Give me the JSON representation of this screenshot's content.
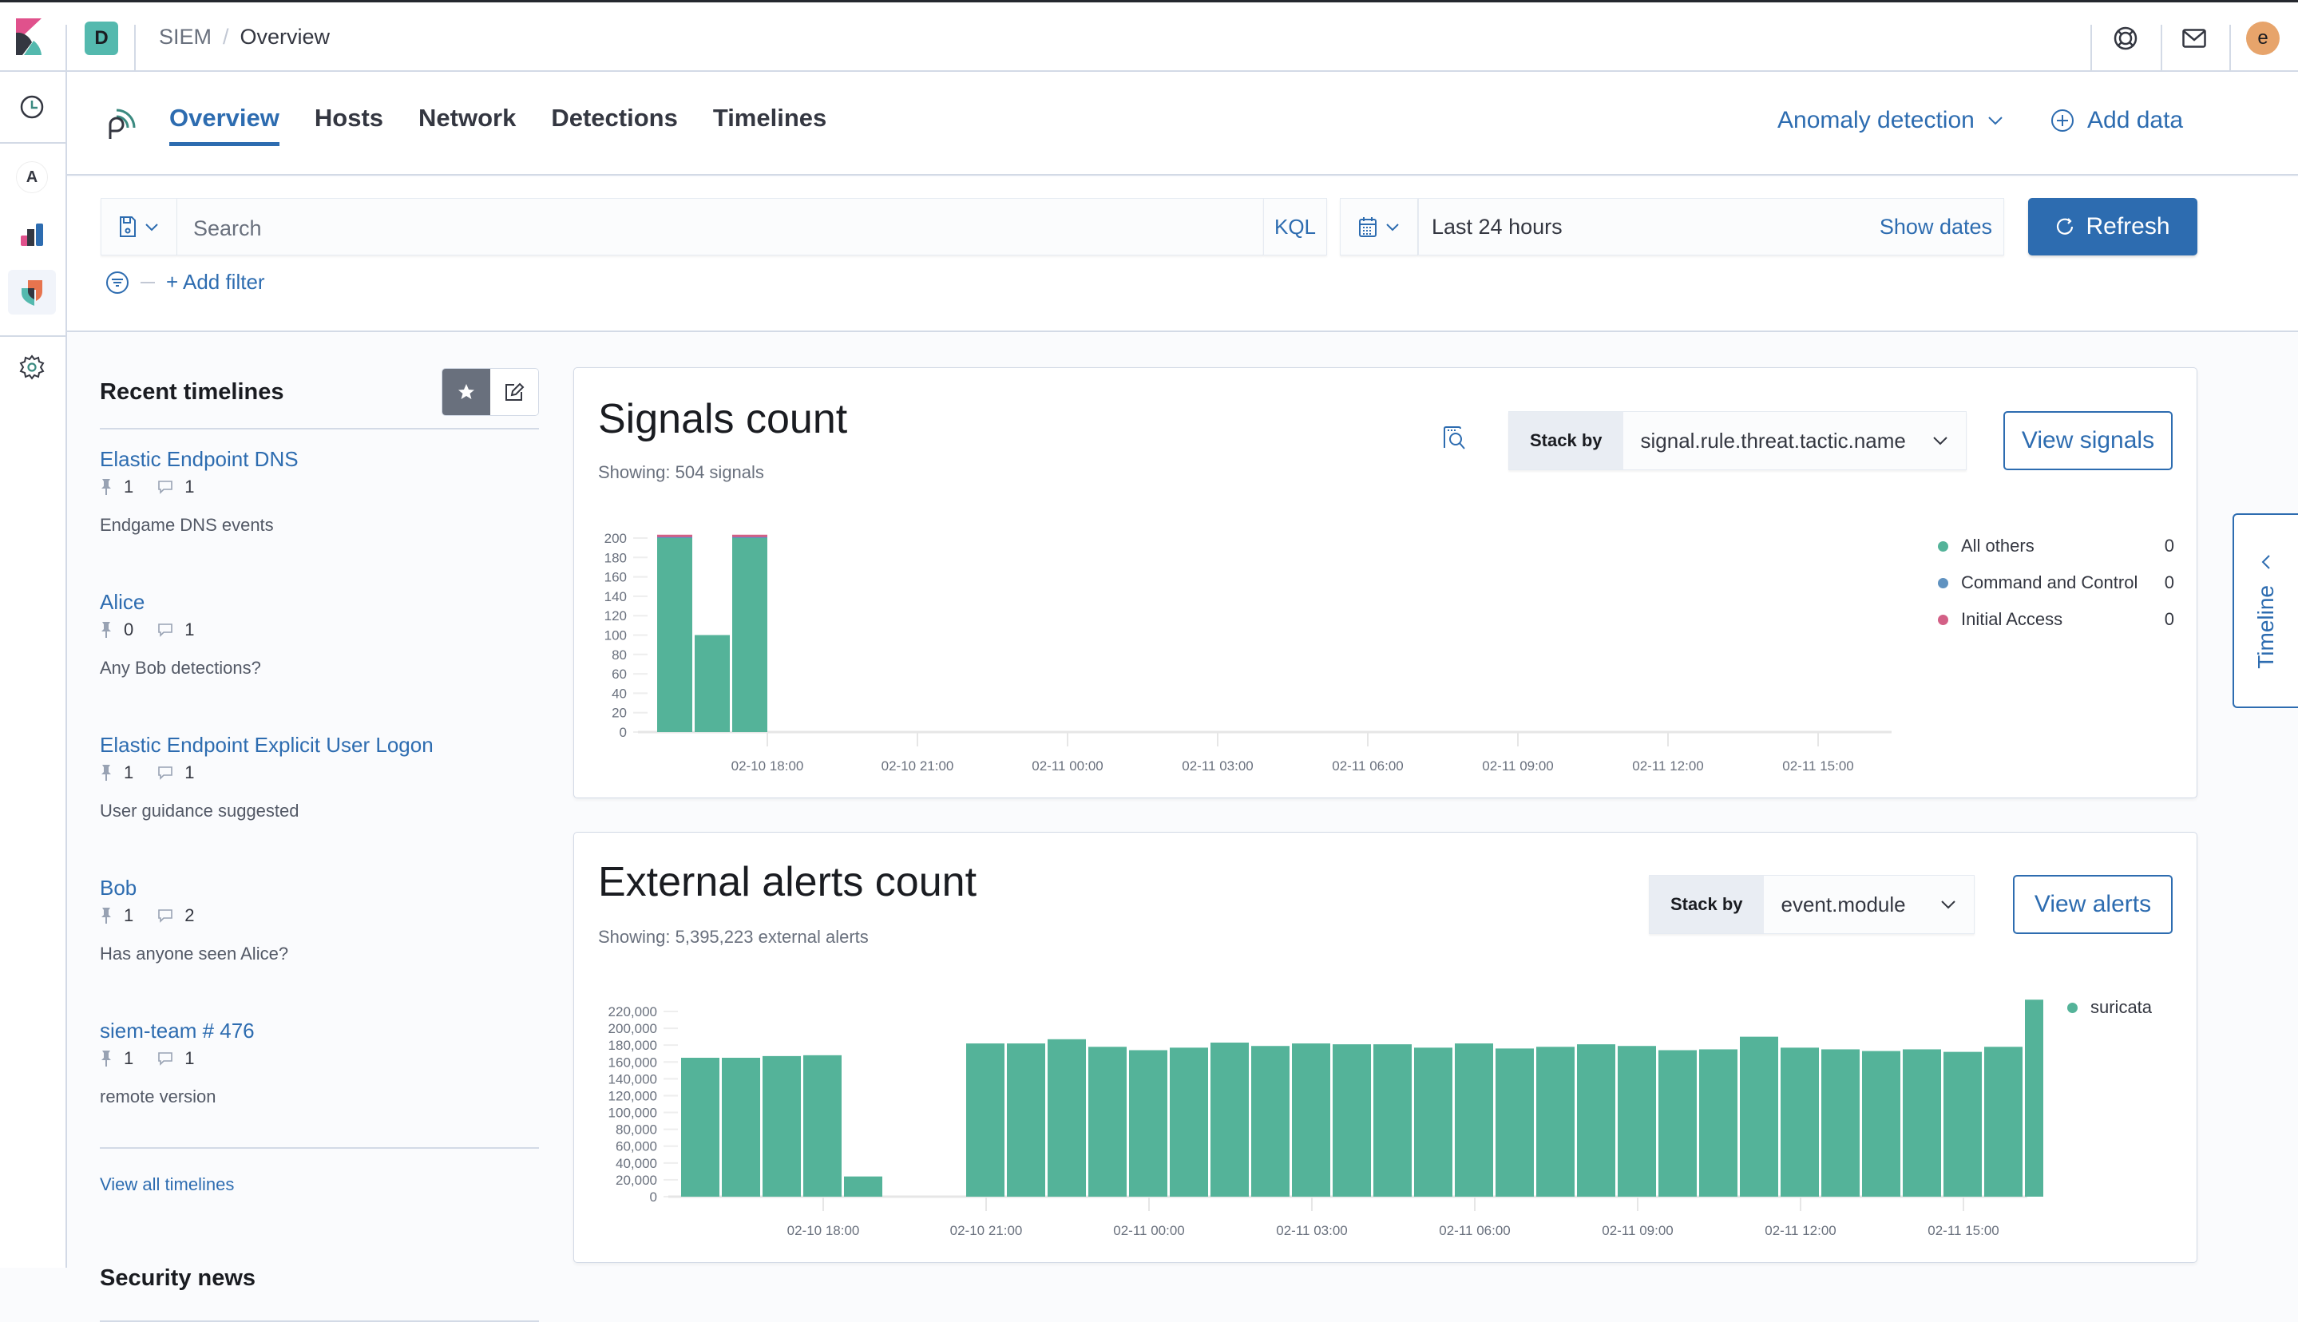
{
  "header": {
    "space_initial": "D",
    "breadcrumb_parent": "SIEM",
    "breadcrumb_separator": "/",
    "breadcrumb_current": "Overview",
    "user_initial": "e",
    "icons": [
      "help-icon",
      "newsfeed-icon",
      "user-avatar"
    ]
  },
  "leftnav": {
    "items": [
      "recently-viewed",
      "app-A",
      "visualize",
      "siem",
      "management"
    ],
    "app_letter": "A"
  },
  "subnav": {
    "tabs": [
      {
        "label": "Overview",
        "selected": true
      },
      {
        "label": "Hosts",
        "selected": false
      },
      {
        "label": "Network",
        "selected": false
      },
      {
        "label": "Detections",
        "selected": false
      },
      {
        "label": "Timelines",
        "selected": false
      }
    ],
    "anomaly_label": "Anomaly detection",
    "add_data_label": "Add data"
  },
  "querybar": {
    "search_placeholder": "Search",
    "language": "KQL",
    "time_range": "Last 24 hours",
    "show_dates": "Show dates",
    "refresh_label": "Refresh",
    "add_filter": "+ Add filter"
  },
  "sidebar": {
    "title": "Recent timelines",
    "timelines": [
      {
        "title": "Elastic Endpoint DNS",
        "pins": "1",
        "notes": "1",
        "description": "Endgame DNS events"
      },
      {
        "title": "Alice",
        "pins": "0",
        "notes": "1",
        "description": "Any Bob detections?"
      },
      {
        "title": "Elastic Endpoint Explicit User Logon",
        "pins": "1",
        "notes": "1",
        "description": "User guidance suggested"
      },
      {
        "title": "Bob",
        "pins": "1",
        "notes": "2",
        "description": "Has anyone seen Alice?"
      },
      {
        "title": "siem-team # 476",
        "pins": "1",
        "notes": "1",
        "description": "remote version"
      }
    ],
    "view_all": "View all timelines",
    "news_title": "Security news"
  },
  "signals": {
    "title": "Signals count",
    "subtitle": "Showing: 504 signals",
    "stack_by_label": "Stack by",
    "stack_by_value": "signal.rule.threat.tactic.name",
    "button": "View signals",
    "legend": [
      {
        "name": "All others",
        "value": "0",
        "color": "#54b399"
      },
      {
        "name": "Command and Control",
        "value": "0",
        "color": "#6092c0"
      },
      {
        "name": "Initial Access",
        "value": "0",
        "color": "#d36086"
      }
    ]
  },
  "external": {
    "title": "External alerts count",
    "subtitle": "Showing: 5,395,223 external alerts",
    "stack_by_label": "Stack by",
    "stack_by_value": "event.module",
    "button": "View alerts",
    "legend": [
      {
        "name": "suricata",
        "color": "#54b399"
      }
    ]
  },
  "timeline_flyout": {
    "label": "Timeline"
  },
  "chart_data": [
    {
      "type": "bar",
      "title": "Signals count",
      "stacked": true,
      "ylim": [
        0,
        200
      ],
      "yticks": [
        0,
        20,
        40,
        60,
        80,
        100,
        120,
        140,
        160,
        180,
        200
      ],
      "xticks": [
        "02-10 18:00",
        "02-10 21:00",
        "02-11 00:00",
        "02-11 03:00",
        "02-11 06:00",
        "02-11 09:00",
        "02-11 12:00",
        "02-11 15:00"
      ],
      "x_slots": 25,
      "series": [
        {
          "name": "All others",
          "color": "#54b399",
          "values": [
            200,
            100,
            200
          ]
        },
        {
          "name": "Command and Control",
          "color": "#6092c0",
          "values": [
            1,
            0,
            1
          ]
        },
        {
          "name": "Initial Access",
          "color": "#d36086",
          "values": [
            1,
            0,
            1
          ]
        }
      ],
      "grid": true,
      "legend": "right"
    },
    {
      "type": "bar",
      "title": "External alerts count",
      "ylim": [
        0,
        220000
      ],
      "yticks": [
        0,
        20000,
        40000,
        60000,
        80000,
        100000,
        120000,
        140000,
        160000,
        180000,
        200000,
        220000
      ],
      "ytick_labels": [
        "0",
        "20,000",
        "40,000",
        "60,000",
        "80,000",
        "100,000",
        "120,000",
        "140,000",
        "160,000",
        "180,000",
        "200,000",
        "220,000"
      ],
      "xticks": [
        "02-10 18:00",
        "02-10 21:00",
        "02-11 00:00",
        "02-11 03:00",
        "02-11 06:00",
        "02-11 09:00",
        "02-11 12:00",
        "02-11 15:00"
      ],
      "series": [
        {
          "name": "suricata",
          "color": "#54b399",
          "values": [
            165000,
            165000,
            167000,
            168000,
            24000,
            0,
            0,
            182000,
            182000,
            187000,
            178000,
            174000,
            177000,
            183000,
            179000,
            182000,
            181000,
            181000,
            177000,
            182000,
            176000,
            178000,
            181000,
            179000,
            174000,
            175000,
            190000,
            177000,
            175000,
            173000,
            175000,
            172000,
            178000,
            234000,
            3000
          ]
        }
      ],
      "grid": true,
      "legend": "right"
    }
  ]
}
